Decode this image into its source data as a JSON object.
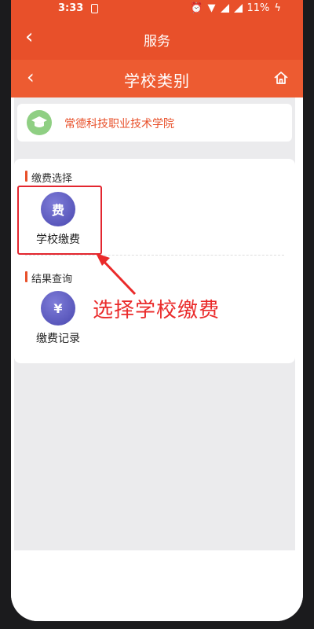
{
  "status_bar": {
    "time": "3:33",
    "battery": "11%"
  },
  "top_bar": {
    "title": "服务"
  },
  "nav_bar": {
    "title": "学校类别"
  },
  "school_card": {
    "name": "常德科技职业技术学院"
  },
  "sections": {
    "payment": {
      "title": "缴费选择",
      "tile_icon_text": "费",
      "tile_label": "学校缴费"
    },
    "query": {
      "title": "结果查询",
      "tile_icon_text": "¥",
      "tile_label": "缴费记录"
    }
  },
  "annotation": {
    "text": "选择学校缴费"
  },
  "colors": {
    "brand": "#e8502a",
    "annotation": "#ea2a2a"
  }
}
